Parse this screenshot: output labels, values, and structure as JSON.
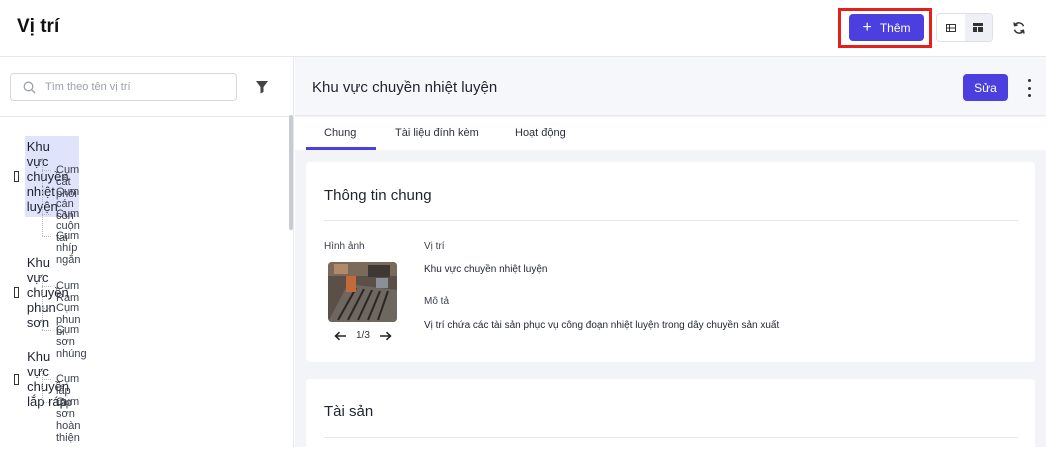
{
  "header": {
    "title": "Vị trí",
    "add_label": "Thêm"
  },
  "sidebar": {
    "search_placeholder": "Tìm theo tên vị trí",
    "groups": [
      {
        "label": "Khu vực chuyền nhiệt luyện",
        "children": [
          "Cụm cắt phôi",
          "Cụm cán côn",
          "Cụm cuộn tai",
          "Cụm nhíp ngắn"
        ]
      },
      {
        "label": "Khu vực chuyền phun sơn",
        "children": [
          "Cụm Ram",
          "Cụm phun bi",
          "Cụm sơn nhúng"
        ]
      },
      {
        "label": "Khu vực chuyền lắp ráp",
        "children": [
          "Cụm lắp ráp",
          "Cụm sơn hoàn thiện"
        ]
      }
    ]
  },
  "detail": {
    "title": "Khu vực chuyền nhiệt luyện",
    "edit_label": "Sửa",
    "tabs": [
      "Chung",
      "Tài liệu đính kèm",
      "Hoạt động"
    ],
    "general": {
      "heading": "Thông tin chung",
      "image_label": "Hình ảnh",
      "pager_text": "1/3",
      "location_label": "Vị trí",
      "location_value": "Khu vực chuyền nhiệt luyện",
      "description_label": "Mô tả",
      "description_value": "Vị trí chứa các tài sản phục vụ công đoạn nhiệt luyện trong dây chuyền sản xuất"
    },
    "assets_heading": "Tài sản"
  },
  "icons": {
    "add": "plus-icon",
    "view_table": "table-view-icon",
    "view_grid": "grid-view-icon",
    "refresh": "refresh-icon",
    "search": "search-icon",
    "filter": "filter-icon",
    "more": "more-vertical-icon",
    "prev": "arrow-left-icon",
    "next": "arrow-right-icon"
  },
  "colors": {
    "primary": "#4b3fe0",
    "highlight": "#e3201b",
    "selected_bg": "#dfe3fb"
  }
}
